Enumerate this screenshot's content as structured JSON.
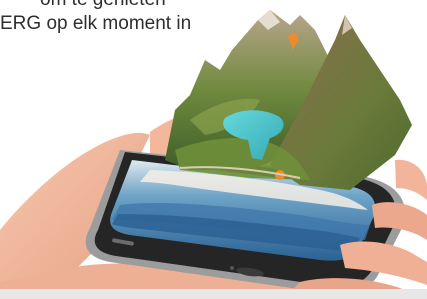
{
  "text": {
    "line1": "om te genieten",
    "line2": "ERG op elk moment in"
  },
  "image": {
    "subject": "hand-holding-smartphone-with-3d-mountain-landscape-icon",
    "colors": {
      "phone_body": "#2a2a2a",
      "phone_frame": "#9a9a9a",
      "sea": "#2f6fa3",
      "lake": "#4fc8cf",
      "mountain_green": "#5f7d3a",
      "mountain_brown": "#8a6b4a",
      "skin": "#f2b49a",
      "marker": "#f08a2a"
    }
  }
}
